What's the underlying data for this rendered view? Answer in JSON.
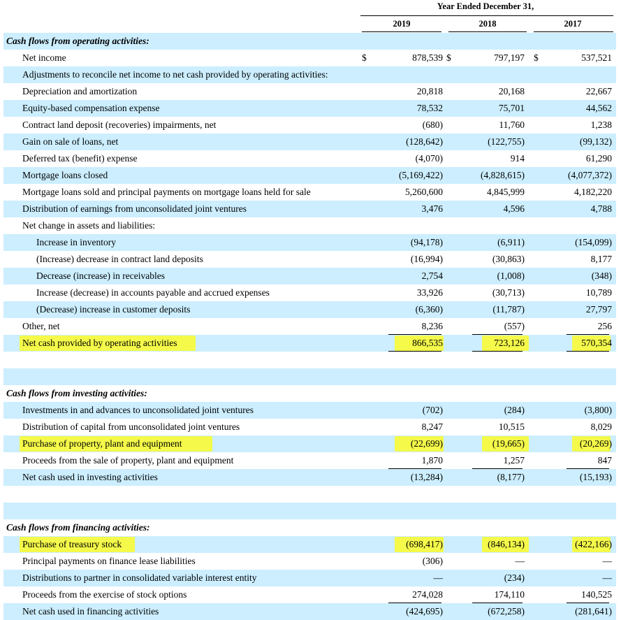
{
  "header": {
    "period": "Year Ended December 31,",
    "years": [
      "2019",
      "2018",
      "2017"
    ]
  },
  "rows": [
    {
      "label": "Cash flows from operating activities:",
      "type": "section",
      "shade": true
    },
    {
      "label": "Net income",
      "type": "line",
      "shade": false,
      "dollar": true,
      "values": [
        "878,539",
        "797,197",
        "537,521"
      ]
    },
    {
      "label": "Adjustments to reconcile net income to net cash provided by operating activities:",
      "type": "line",
      "shade": true
    },
    {
      "label": "Depreciation and amortization",
      "type": "line",
      "shade": false,
      "values": [
        "20,818",
        "20,168",
        "22,667"
      ]
    },
    {
      "label": "Equity-based compensation expense",
      "type": "line",
      "shade": true,
      "values": [
        "78,532",
        "75,701",
        "44,562"
      ]
    },
    {
      "label": "Contract land deposit (recoveries) impairments, net",
      "type": "line",
      "shade": false,
      "values": [
        "(680)",
        "11,760",
        "1,238"
      ]
    },
    {
      "label": "Gain on sale of loans, net",
      "type": "line",
      "shade": true,
      "values": [
        "(128,642)",
        "(122,755)",
        "(99,132)"
      ]
    },
    {
      "label": "Deferred tax (benefit) expense",
      "type": "line",
      "shade": false,
      "values": [
        "(4,070)",
        "914",
        "61,290"
      ]
    },
    {
      "label": "Mortgage loans closed",
      "type": "line",
      "shade": true,
      "values": [
        "(5,169,422)",
        "(4,828,615)",
        "(4,077,372)"
      ]
    },
    {
      "label": "Mortgage loans sold and principal payments on mortgage loans held for sale",
      "type": "line",
      "shade": false,
      "values": [
        "5,260,600",
        "4,845,999",
        "4,182,220"
      ]
    },
    {
      "label": "Distribution of earnings from unconsolidated joint ventures",
      "type": "line",
      "shade": true,
      "values": [
        "3,476",
        "4,596",
        "4,788"
      ]
    },
    {
      "label": "Net change in assets and liabilities:",
      "type": "line",
      "shade": false
    },
    {
      "label": "Increase in inventory",
      "type": "indent",
      "shade": true,
      "values": [
        "(94,178)",
        "(6,911)",
        "(154,099)"
      ]
    },
    {
      "label": "(Increase) decrease in contract land deposits",
      "type": "indent",
      "shade": false,
      "values": [
        "(16,994)",
        "(30,863)",
        "8,177"
      ]
    },
    {
      "label": "Decrease (increase) in receivables",
      "type": "indent",
      "shade": true,
      "values": [
        "2,754",
        "(1,008)",
        "(348)"
      ]
    },
    {
      "label": "Increase (decrease) in accounts payable and accrued expenses",
      "type": "indent",
      "shade": false,
      "values": [
        "33,926",
        "(30,713)",
        "10,789"
      ]
    },
    {
      "label": "(Decrease) increase in customer deposits",
      "type": "indent",
      "shade": true,
      "values": [
        "(6,360)",
        "(11,787)",
        "27,797"
      ]
    },
    {
      "label": "Other, net",
      "type": "line",
      "shade": false,
      "values": [
        "8,236",
        "(557)",
        "256"
      ]
    },
    {
      "label": "Net cash provided by operating activities",
      "type": "line",
      "shade": true,
      "highlight": true,
      "values": [
        "866,535",
        "723,126",
        "570,354"
      ]
    },
    {
      "label": "",
      "type": "blank",
      "shade": false
    },
    {
      "label": "",
      "type": "blank",
      "shade": true
    },
    {
      "label": "Cash flows from investing activities:",
      "type": "section",
      "shade": false
    },
    {
      "label": "Investments in and advances to unconsolidated joint ventures",
      "type": "line",
      "shade": true,
      "values": [
        "(702)",
        "(284)",
        "(3,800)"
      ]
    },
    {
      "label": "Distribution of capital from unconsolidated joint ventures",
      "type": "line",
      "shade": false,
      "values": [
        "8,247",
        "10,515",
        "8,029"
      ]
    },
    {
      "label": "Purchase of property, plant and equipment",
      "type": "line",
      "shade": true,
      "highlight": true,
      "values": [
        "(22,699)",
        "(19,665)",
        "(20,269)"
      ]
    },
    {
      "label": "Proceeds from the sale of property, plant and equipment",
      "type": "line",
      "shade": false,
      "values": [
        "1,870",
        "1,257",
        "847"
      ]
    },
    {
      "label": "Net cash used in investing activities",
      "type": "line",
      "shade": true,
      "values": [
        "(13,284)",
        "(8,177)",
        "(15,193)"
      ]
    },
    {
      "label": "",
      "type": "blank",
      "shade": false
    },
    {
      "label": "",
      "type": "blank",
      "shade": true
    },
    {
      "label": "Cash flows from financing activities:",
      "type": "section",
      "shade": false
    },
    {
      "label": "Purchase of treasury stock",
      "type": "line",
      "shade": true,
      "highlight": true,
      "values": [
        "(698,417)",
        "(846,134)",
        "(422,166)"
      ]
    },
    {
      "label": "Principal payments on finance lease liabilities",
      "type": "line",
      "shade": false,
      "values": [
        "(306)",
        "—",
        "—"
      ]
    },
    {
      "label": "Distributions to partner in consolidated variable interest entity",
      "type": "line",
      "shade": true,
      "values": [
        "—",
        "(234)",
        "—"
      ]
    },
    {
      "label": "Proceeds from the exercise of stock options",
      "type": "line",
      "shade": false,
      "values": [
        "274,028",
        "174,110",
        "140,525"
      ]
    },
    {
      "label": "Net cash used in financing activities",
      "type": "line",
      "shade": true,
      "values": [
        "(424,695)",
        "(672,258)",
        "(281,641)"
      ]
    }
  ],
  "dollar_sign": "$",
  "colors": {
    "shade": "#cceeff",
    "highlight": "#f4f94a"
  }
}
